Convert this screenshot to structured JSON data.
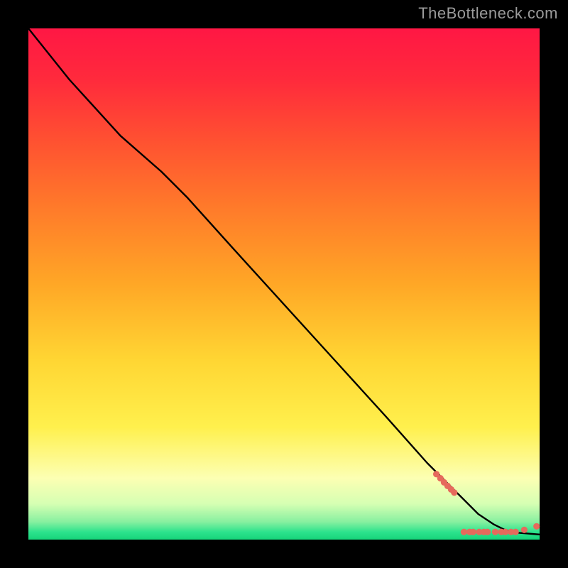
{
  "watermark": "TheBottleneck.com",
  "colors": {
    "line": "#000000",
    "dot": "#e66a5c"
  },
  "chart_data": {
    "type": "line",
    "title": "",
    "xlabel": "",
    "ylabel": "",
    "xlim": [
      0,
      100
    ],
    "ylim": [
      0,
      100
    ],
    "grid": false,
    "series": [
      {
        "name": "curve",
        "x": [
          0,
          8,
          18,
          26,
          31,
          40,
          50,
          60,
          70,
          78,
          82,
          85,
          88,
          91,
          93,
          95,
          100
        ],
        "y": [
          100,
          90,
          79,
          72,
          67,
          57,
          46,
          35,
          24,
          15,
          11,
          8,
          5,
          3,
          2,
          1.4,
          1.0
        ]
      }
    ],
    "scatter": {
      "name": "dots",
      "x": [
        79.8,
        80.6,
        81.3,
        82.0,
        82.7,
        83.3,
        85.2,
        86.3,
        87.0,
        88.2,
        89.1,
        89.8,
        91.3,
        92.5,
        93.3,
        94.4,
        95.3,
        97.0,
        99.4
      ],
      "y": [
        12.8,
        12.0,
        11.2,
        10.5,
        9.8,
        9.2,
        1.5,
        1.5,
        1.5,
        1.5,
        1.5,
        1.5,
        1.5,
        1.5,
        1.5,
        1.5,
        1.5,
        1.9,
        2.6
      ]
    }
  }
}
